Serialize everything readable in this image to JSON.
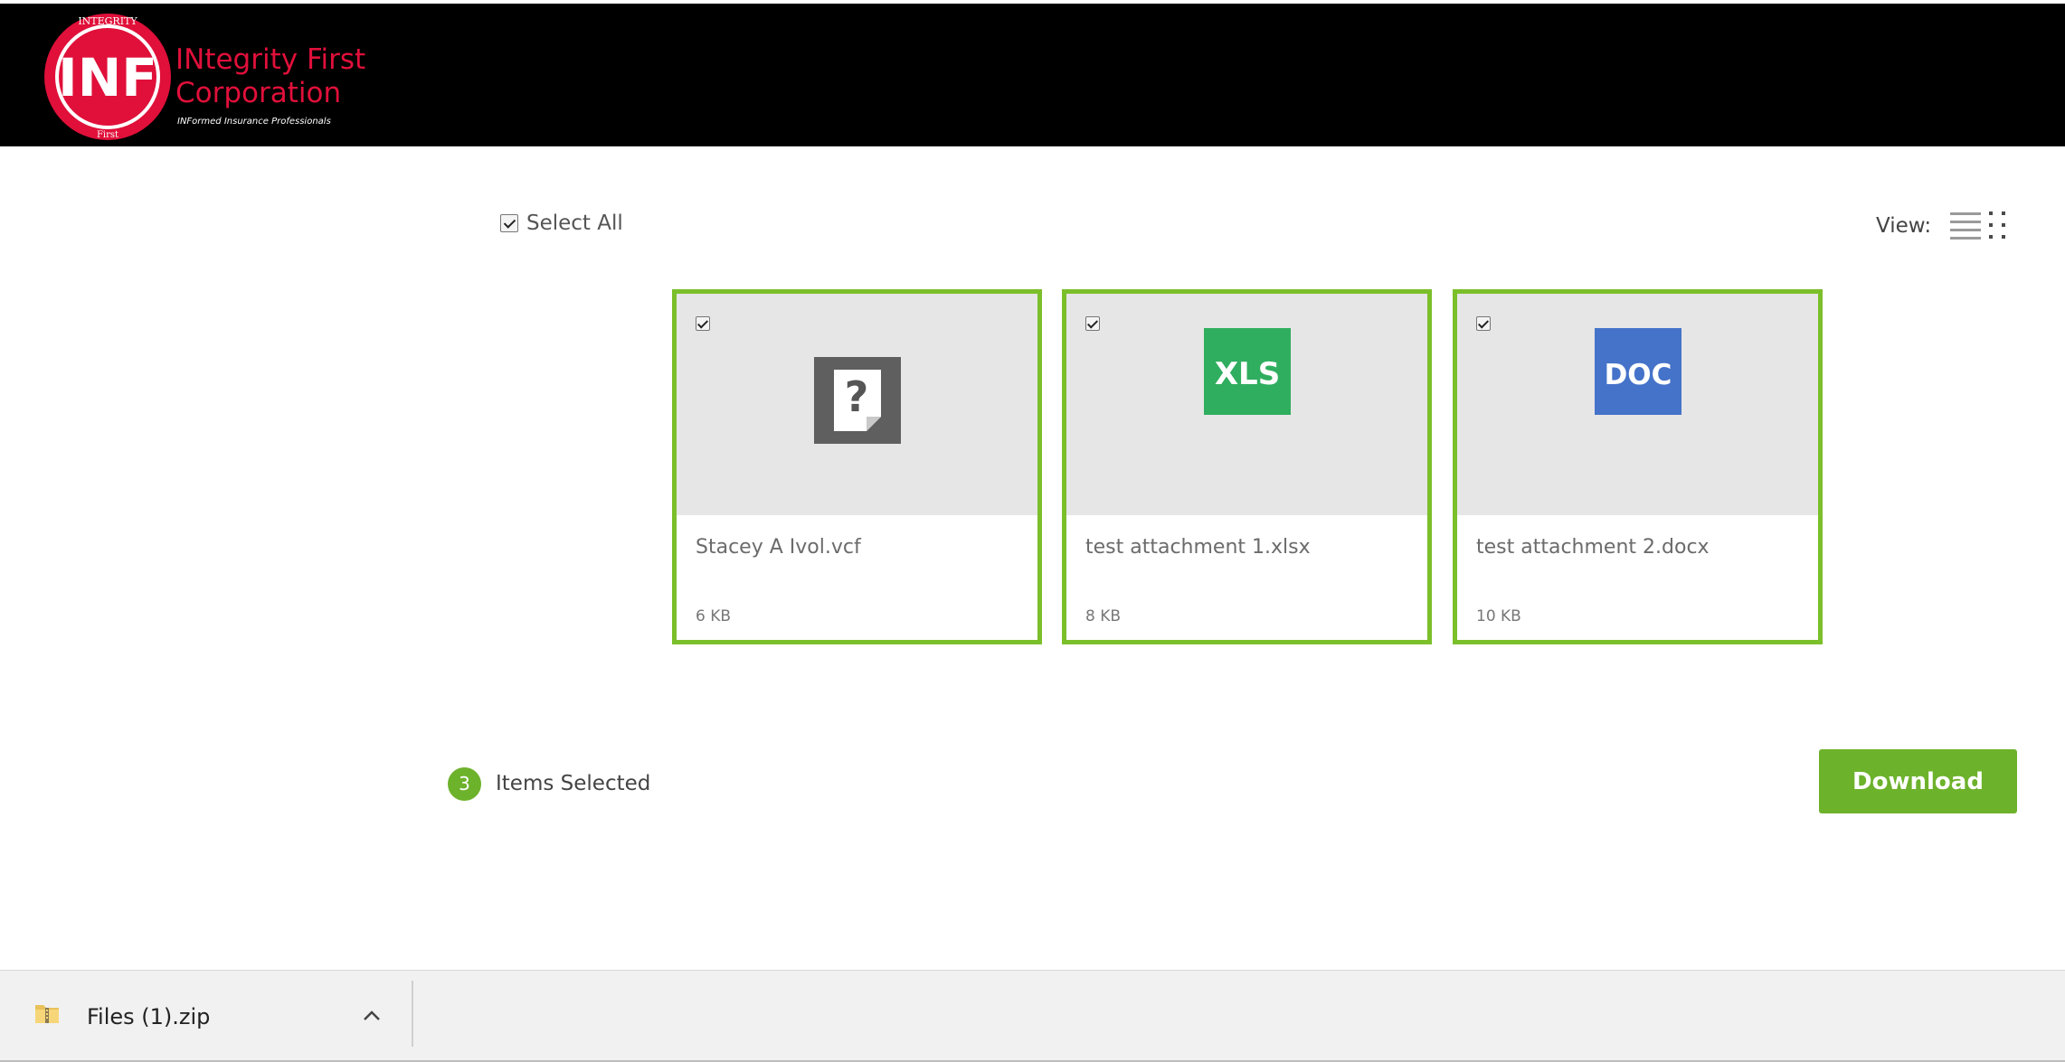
{
  "colors": {
    "header_bg": "#000000",
    "brand_red": "#e0103a",
    "accent_green": "#6db22b",
    "card_border": "#7bbf2a",
    "xls_green": "#2fae5f",
    "doc_blue": "#4573c9"
  },
  "header": {
    "logo": {
      "monogram": "INF",
      "ring_top": "INTEGRITY",
      "ring_bottom": "First",
      "title_line1": "INtegrity First",
      "title_line2": "Corporation",
      "tagline": "INFormed Insurance Professionals"
    }
  },
  "toolbar": {
    "select_all_label": "Select All",
    "select_all_checked": true,
    "view_label": "View:",
    "view_icons": [
      "list-view-icon",
      "grid-view-icon"
    ]
  },
  "files": [
    {
      "name": "Stacey A Ivol.vcf",
      "size": "6 KB",
      "icon": "unknown-file-icon",
      "checked": true
    },
    {
      "name": "test attachment 1.xlsx",
      "size": "8 KB",
      "icon": "xls-file-icon",
      "icon_text": "XLS",
      "checked": true
    },
    {
      "name": "test attachment 2.docx",
      "size": "10 KB",
      "icon": "doc-file-icon",
      "icon_text": "DOC",
      "checked": true
    }
  ],
  "selection": {
    "count": "3",
    "label": "Items Selected"
  },
  "actions": {
    "download_label": "Download"
  },
  "download_bar": {
    "file_name": "Files (1).zip",
    "icon": "zip-folder-icon",
    "menu_icon": "chevron-up-icon"
  }
}
